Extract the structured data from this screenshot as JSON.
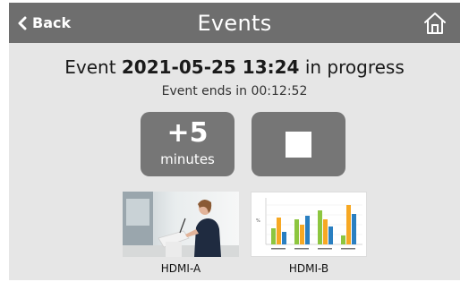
{
  "header": {
    "back_label": "Back",
    "title": "Events",
    "home_icon": "home-icon"
  },
  "event": {
    "prefix": "Event",
    "datetime": "2021-05-25 13:24",
    "suffix": "in progress",
    "ends_text": "Event ends in 00:12:52"
  },
  "controls": {
    "extend_value": "+5",
    "extend_unit": "minutes",
    "stop_icon": "stop-icon"
  },
  "sources": [
    {
      "label": "HDMI-A"
    },
    {
      "label": "HDMI-B"
    }
  ],
  "colors": {
    "topbar": "#6e6e6e",
    "background": "#e6e6e6",
    "button": "#767676"
  }
}
